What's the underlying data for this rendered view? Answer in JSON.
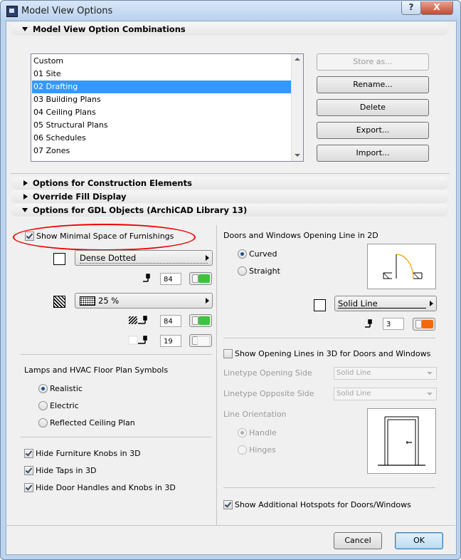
{
  "window": {
    "title": "Model View Options",
    "help_label": "?",
    "close_label": "X"
  },
  "combinations": {
    "header": "Model View Option Combinations",
    "items": [
      "Custom",
      "01 Site",
      "02 Drafting",
      "03 Building Plans",
      "04 Ceiling Plans",
      "05 Structural Plans",
      "06 Schedules",
      "07 Zones"
    ],
    "selected_index": 2,
    "buttons": {
      "store": "Store as...",
      "rename": "Rename...",
      "delete": "Delete",
      "export": "Export...",
      "import": "Import..."
    }
  },
  "sections": {
    "construction": "Options for Construction Elements",
    "override_fill": "Override Fill Display",
    "gdl": "Options for GDL Objects (ArchiCAD Library 13)"
  },
  "left": {
    "show_minimal_space": "Show Minimal Space of Furnishings",
    "line_type": "Dense Dotted",
    "line_pen": "84",
    "fill_type": "25 %",
    "fill_pen": "84",
    "bg_pen": "19",
    "lamps_header": "Lamps and HVAC Floor Plan Symbols",
    "radio_realistic": "Realistic",
    "radio_electric": "Electric",
    "radio_reflected": "Reflected Ceiling Plan",
    "hide_knobs": "Hide Furniture Knobs in 3D",
    "hide_taps": "Hide Taps in 3D",
    "hide_handles": "Hide Door Handles and Knobs in 3D"
  },
  "right": {
    "opening_header": "Doors and Windows Opening Line in 2D",
    "radio_curved": "Curved",
    "radio_straight": "Straight",
    "line_type": "Solid Line",
    "pen": "3",
    "show_opening_3d": "Show Opening Lines in 3D for Doors and Windows",
    "linetype_opening": "Linetype Opening Side",
    "linetype_opening_value": "Solid Line",
    "linetype_opposite": "Linetype Opposite Side",
    "linetype_opposite_value": "Solid Line",
    "orientation": "Line Orientation",
    "radio_handle": "Handle",
    "radio_hinges": "Hinges",
    "show_hotspots": "Show Additional Hotspots for Doors/Windows"
  },
  "footer": {
    "cancel": "Cancel",
    "ok": "OK"
  },
  "colors": {
    "selection": "#3399ff",
    "toggle_green": "#3cc43c",
    "toggle_orange": "#f26a0c",
    "annotation_red": "#e00000",
    "arc_orange": "#f0a000"
  }
}
